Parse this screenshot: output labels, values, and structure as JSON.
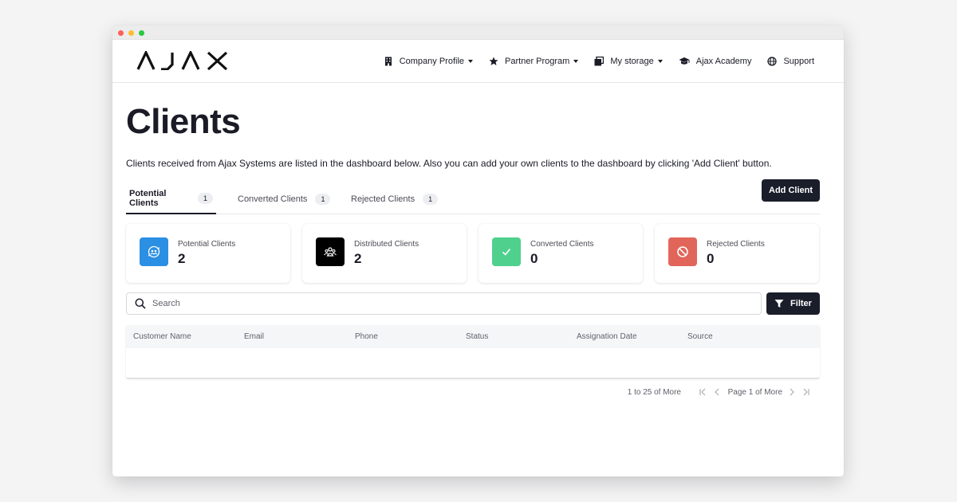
{
  "brand": {
    "logo_text": "AJAX"
  },
  "nav": {
    "items": [
      {
        "label": "Company Profile",
        "icon": "building-icon",
        "dropdown": true
      },
      {
        "label": "Partner Program",
        "icon": "star-icon",
        "dropdown": true
      },
      {
        "label": "My storage",
        "icon": "storage-icon",
        "dropdown": true
      },
      {
        "label": "Ajax Academy",
        "icon": "graduation-cap-icon",
        "dropdown": false
      },
      {
        "label": "Support",
        "icon": "globe-icon",
        "dropdown": false
      }
    ]
  },
  "page": {
    "title": "Clients",
    "subtitle": "Clients received from Ajax Systems are listed in the dashboard below. Also you can add your own clients to the dashboard by clicking 'Add Client' button."
  },
  "tabs": [
    {
      "label": "Potential Clients",
      "count": "1",
      "active": true
    },
    {
      "label": "Converted Clients",
      "count": "1",
      "active": false
    },
    {
      "label": "Rejected Clients",
      "count": "1",
      "active": false
    }
  ],
  "add_client_label": "Add Client",
  "stats": [
    {
      "label": "Potential Clients",
      "value": "2",
      "color": "#2b8fe3",
      "icon": "refresh-people-icon"
    },
    {
      "label": "Distributed Clients",
      "value": "2",
      "color": "#000000",
      "icon": "group-icon"
    },
    {
      "label": "Converted Clients",
      "value": "0",
      "color": "#4fd08d",
      "icon": "check-icon"
    },
    {
      "label": "Rejected Clients",
      "value": "0",
      "color": "#e2655a",
      "icon": "ban-icon"
    }
  ],
  "search": {
    "placeholder": "Search"
  },
  "filter_label": "Filter",
  "table": {
    "columns": [
      "Customer Name",
      "Email",
      "Phone",
      "Status",
      "Assignation Date",
      "Source"
    ],
    "rows": []
  },
  "pagination": {
    "range_text": "1 to 25 of More",
    "page_text": "Page 1 of More"
  }
}
